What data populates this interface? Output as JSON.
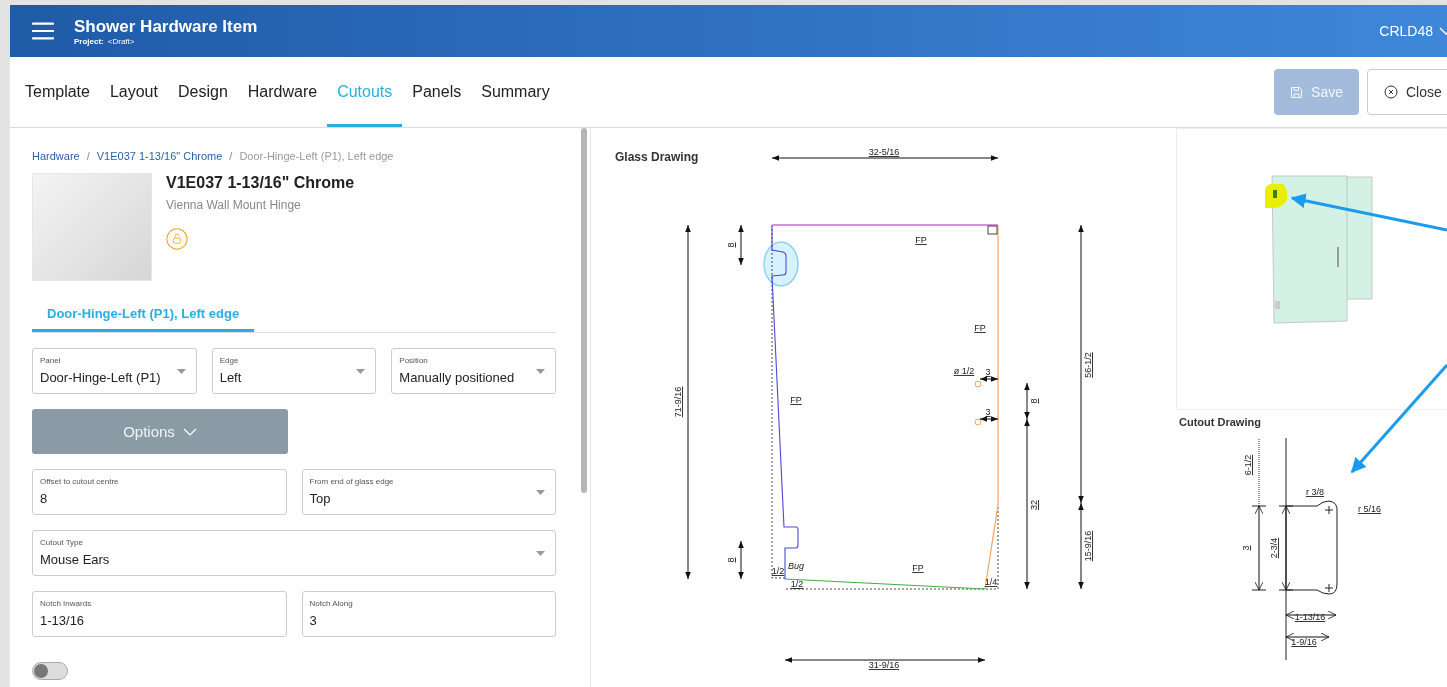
{
  "header": {
    "title": "Shower Hardware Item",
    "project_label": "Project:",
    "project_value": "<Draft>",
    "user": "CRLD48"
  },
  "tabs": [
    {
      "label": "Template",
      "selected": false
    },
    {
      "label": "Layout",
      "selected": false
    },
    {
      "label": "Design",
      "selected": false
    },
    {
      "label": "Hardware",
      "selected": false
    },
    {
      "label": "Cutouts",
      "selected": true
    },
    {
      "label": "Panels",
      "selected": false
    },
    {
      "label": "Summary",
      "selected": false
    }
  ],
  "actions": [
    {
      "label": "Save",
      "kind": "save",
      "disabled": true
    },
    {
      "label": "Close",
      "kind": "close",
      "disabled": false
    }
  ],
  "breadcrumb": [
    {
      "label": "Hardware",
      "current": false
    },
    {
      "separator": "/",
      "label": "V1E037 1-13/16\" Chrome",
      "current": false
    },
    {
      "separator": "/",
      "label": "Door-Hinge-Left (P1), Left edge",
      "current": true
    }
  ],
  "product": {
    "title": "V1E037 1-13/16\" Chrome",
    "subtitle": "Vienna Wall Mount Hinge",
    "locked": false
  },
  "sub_tabs": [
    {
      "label": "Door-Hinge-Left (P1), Left edge",
      "selected": true
    }
  ],
  "field_rows": [
    [
      {
        "label": "Panel",
        "value": "Door-Hinge-Left (P1)",
        "kind": "select"
      },
      {
        "label": "Edge",
        "value": "Left",
        "kind": "select"
      },
      {
        "label": "Position",
        "value": "Manually positioned",
        "kind": "select"
      }
    ],
    [
      {
        "label": "Offset to cutout centre",
        "value": "8",
        "kind": "text"
      },
      {
        "label": "From end of glass edge",
        "value": "Top",
        "kind": "select"
      }
    ],
    [
      {
        "label": "Cutout Type",
        "value": "Mouse Ears",
        "kind": "select"
      }
    ],
    [
      {
        "label": "Notch Inwards",
        "value": "1-13/16",
        "kind": "text"
      },
      {
        "label": "Notch Along",
        "value": "3",
        "kind": "text"
      }
    ]
  ],
  "options_button": {
    "label": "Options"
  },
  "toggle": {
    "on": false
  },
  "glass_drawing": {
    "title": "Glass Drawing",
    "labels": [
      "32-5/16",
      "71-9/16",
      "8",
      "8",
      "FP",
      "FP",
      "FP",
      "FP",
      "ø 1/2",
      "3",
      "3",
      "8",
      "32",
      "56-1/2",
      "15-9/16",
      "Bug",
      "1/2",
      "1/2",
      "1/4",
      "31-9/16"
    ]
  },
  "cutout_drawing": {
    "title": "Cutout Drawing",
    "labels": [
      "6-1/2",
      "3",
      "2-3/4",
      "r 3/8",
      "r 5/16",
      "1-13/16",
      "1-9/16"
    ]
  }
}
